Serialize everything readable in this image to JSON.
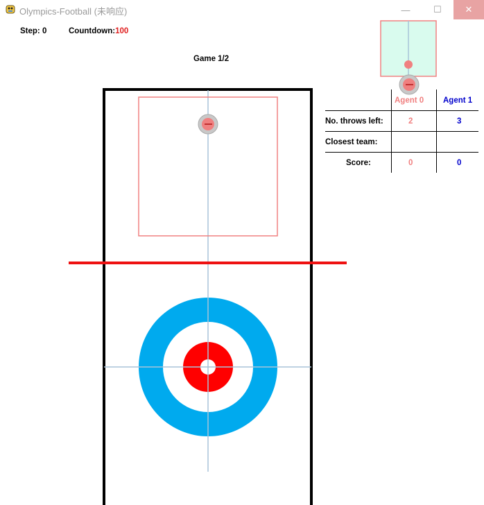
{
  "window": {
    "title": "Olympics-Football (未响应)",
    "minimize_glyph": "—",
    "maximize_glyph": "☐",
    "close_glyph": "✕"
  },
  "status": {
    "step_label": "Step:",
    "step_value": "0",
    "countdown_label": "Countdown:",
    "countdown_value": "100",
    "game_label": "Game 1/2"
  },
  "scoreboard": {
    "agent0": "Agent 0",
    "agent1": "Agent 1",
    "rows": [
      {
        "label": "No. throws left:",
        "agent0": "2",
        "agent1": "3"
      },
      {
        "label": "Closest team:",
        "agent0": "",
        "agent1": ""
      },
      {
        "label": "Score:",
        "agent0": "0",
        "agent1": "0"
      }
    ]
  },
  "colors": {
    "agent0": "#f08080",
    "agent1": "#0000cc",
    "countdown": "#e02020",
    "target_outer": "#00aaee",
    "target_inner": "#ff0000",
    "start_line": "#ee1111",
    "view_bg": "#d9fbee"
  },
  "icons": [
    "app-icon",
    "minimize-icon",
    "maximize-icon",
    "close-icon"
  ]
}
